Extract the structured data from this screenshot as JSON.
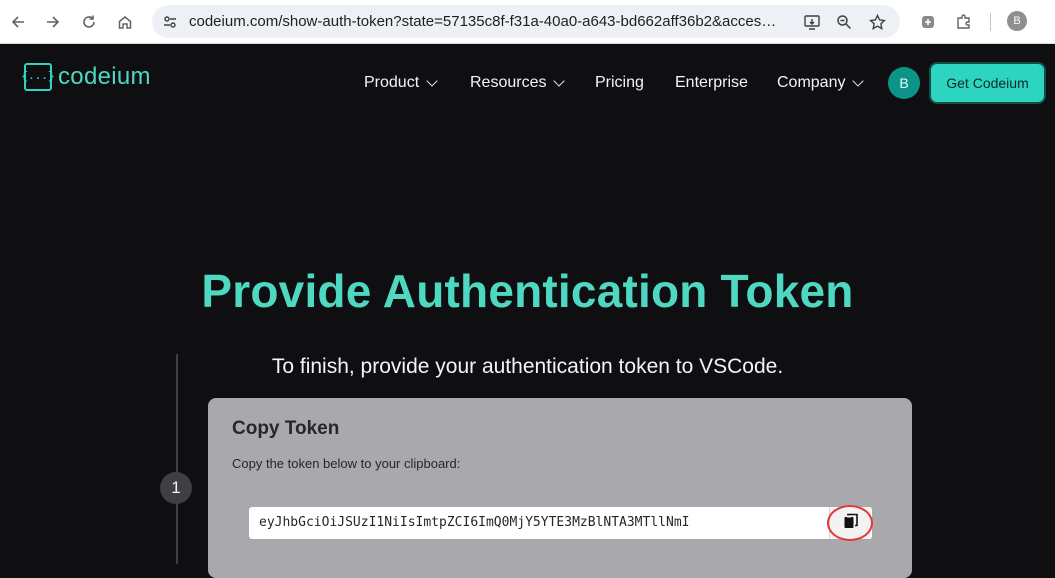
{
  "browser": {
    "url": "codeium.com/show-auth-token?state=57135c8f-f31a-40a0-a643-bd662aff36b2&acces…",
    "profile_initial": "B"
  },
  "header": {
    "brand": "codeium",
    "brand_mark": "{...}",
    "nav": [
      {
        "label": "Product"
      },
      {
        "label": "Resources"
      },
      {
        "label": "Pricing"
      },
      {
        "label": "Enterprise"
      },
      {
        "label": "Company"
      }
    ],
    "avatar_initial": "B",
    "cta_label": "Get Codeium"
  },
  "main": {
    "title": "Provide Authentication Token",
    "subtitle": "To finish, provide your authentication token to VSCode.",
    "step_number": "1",
    "card": {
      "title": "Copy Token",
      "description": "Copy the token below to your clipboard:",
      "token": "eyJhbGciOiJSUzI1NiIsImtpZCI6ImQ0MjY5YTE3MzBlNTA3MTllNmI"
    }
  },
  "colors": {
    "accent": "#2dd4bf",
    "title": "#4fd8c1",
    "background": "#0f0f12",
    "card": "#a9a9ad",
    "highlight_ring": "#e53935"
  },
  "icons": [
    "back-icon",
    "forward-icon",
    "reload-icon",
    "home-icon",
    "site-info-icon",
    "install-app-icon",
    "zoom-icon",
    "bookmark-star-icon",
    "extension-icon",
    "puzzle-icon",
    "clipboard-icon"
  ]
}
